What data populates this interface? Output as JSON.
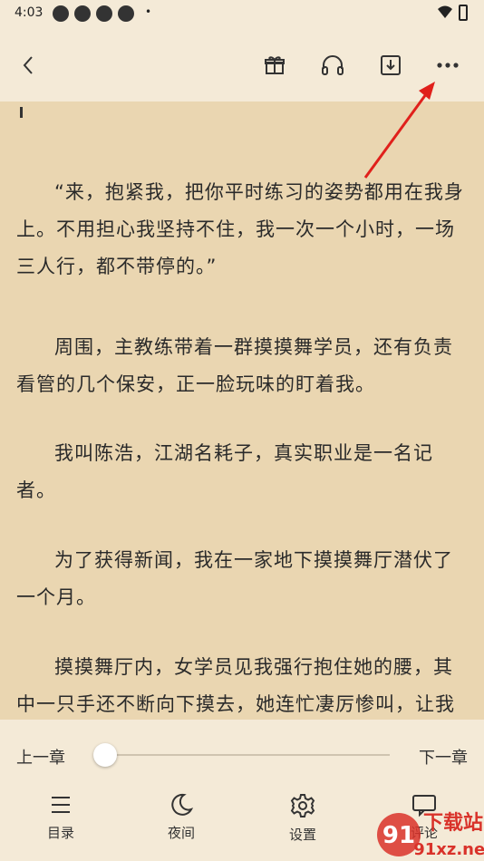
{
  "status_bar": {
    "time": "4:03",
    "dot": "•"
  },
  "toolbar": {
    "back_icon": "chevron-left-icon",
    "gift_icon": "gift-icon",
    "audio_icon": "headphones-icon",
    "download_icon": "download-icon",
    "more_icon": "more-dots-icon"
  },
  "content": {
    "paragraphs": [
      "“来，抱紧我，把你平时练习的姿势都用在我身上。不用担心我坚持不住，我一次一个小时，一场三人行，都不带停的。”",
      "周围，主教练带着一群摸摸舞学员，还有负责看管的几个保安，正一脸玩味的盯着我。",
      "我叫陈浩，江湖名耗子，真实职业是一名记者。",
      "为了获得新闻，我在一家地下摸摸舞厅潜伏了一个月。",
      "摸摸舞厅内，女学员见我强行抱住她的腰，其中一只手还不断向下摸去，她连忙凄厉惨叫，让我"
    ]
  },
  "progress": {
    "prev_label": "上一章",
    "next_label": "下一章",
    "position_fraction": 0.0
  },
  "bottom_nav": {
    "items": [
      {
        "label": "目录",
        "icon": "menu-list-icon"
      },
      {
        "label": "夜间",
        "icon": "moon-icon"
      },
      {
        "label": "设置",
        "icon": "gear-icon"
      },
      {
        "label": "评论",
        "icon": "comment-icon"
      }
    ]
  },
  "watermark": {
    "text_top": "下载站",
    "text_bottom": "91xz.net"
  },
  "colors": {
    "paper": "#ead6b1",
    "chrome": "#f4ead7",
    "annotation": "#e0201b"
  }
}
